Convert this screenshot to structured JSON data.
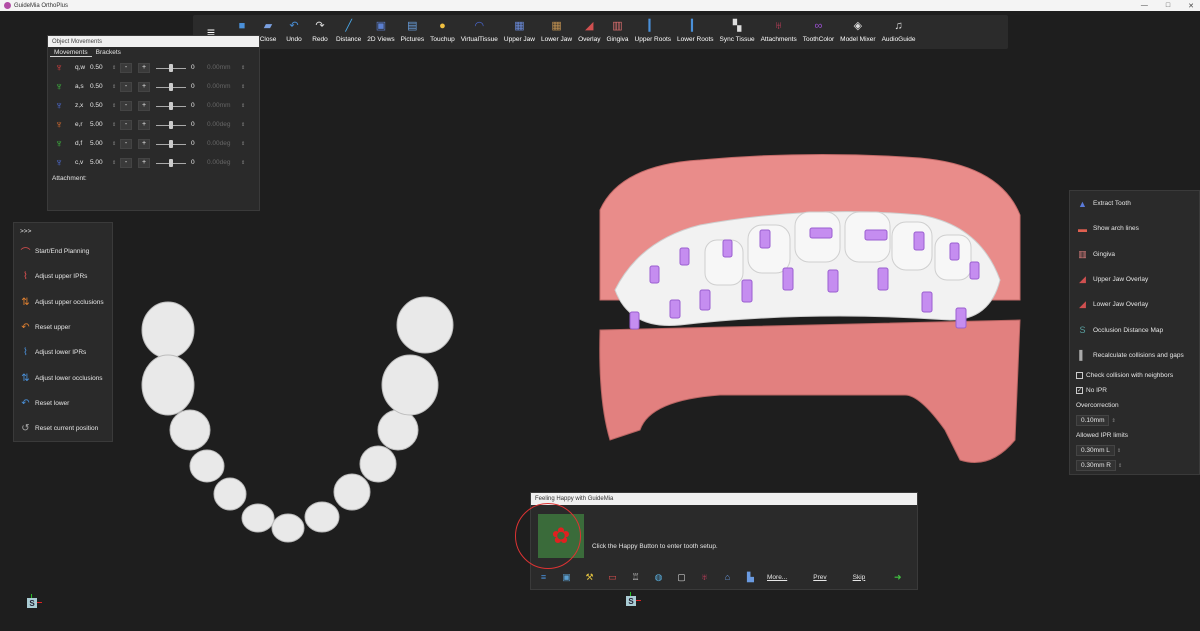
{
  "app": {
    "title": "GuideMia OrthoPlus"
  },
  "window_controls": {
    "minimize": "—",
    "maximize": "□",
    "close": "✕"
  },
  "toolbar": {
    "menu_icon": "≡",
    "items": [
      {
        "icon": "save-icon",
        "glyph": "■",
        "color": "#4a90d9",
        "label": ""
      },
      {
        "icon": "close-icon",
        "glyph": "▰",
        "color": "#7aa0e0",
        "label": "Close"
      },
      {
        "icon": "undo-icon",
        "glyph": "↶",
        "color": "#4a90d9",
        "label": "Undo"
      },
      {
        "icon": "redo-icon",
        "glyph": "↷",
        "color": "#dddddd",
        "label": "Redo"
      },
      {
        "icon": "ruler-icon",
        "glyph": "╱",
        "color": "#4aa8e8",
        "label": "Distance"
      },
      {
        "icon": "2d-views-icon",
        "glyph": "▣",
        "color": "#5b7fd0",
        "label": "2D Views"
      },
      {
        "icon": "pictures-icon",
        "glyph": "▤",
        "color": "#6aa0e0",
        "label": "Pictures"
      },
      {
        "icon": "touchup-icon",
        "glyph": "●",
        "color": "#f0c040",
        "label": "Touchup"
      },
      {
        "icon": "virtual-tissue-icon",
        "glyph": "◠",
        "color": "#4a6ad9",
        "label": "VirtualTissue"
      },
      {
        "icon": "upper-jaw-icon",
        "glyph": "▦",
        "color": "#6a8ad9",
        "label": "Upper Jaw"
      },
      {
        "icon": "lower-jaw-icon",
        "glyph": "▦",
        "color": "#c09050",
        "label": "Lower Jaw"
      },
      {
        "icon": "overlay-icon",
        "glyph": "◢",
        "color": "#d05050",
        "label": "Overlay"
      },
      {
        "icon": "gingiva-icon",
        "glyph": "▥",
        "color": "#e07070",
        "label": "Gingiva"
      },
      {
        "icon": "upper-roots-icon",
        "glyph": "▎",
        "color": "#4a90d9",
        "label": "Upper Roots"
      },
      {
        "icon": "lower-roots-icon",
        "glyph": "▎",
        "color": "#4a90d9",
        "label": "Lower Roots"
      },
      {
        "icon": "sync-tissue-icon",
        "glyph": "▚",
        "color": "#dddddd",
        "label": "Sync Tissue"
      },
      {
        "icon": "attachments-icon",
        "glyph": "♅",
        "color": "#d04060",
        "label": "Attachments"
      },
      {
        "icon": "tooth-color-icon",
        "glyph": "∞",
        "color": "#9a50d0",
        "label": "ToothColor"
      },
      {
        "icon": "model-mixer-icon",
        "glyph": "◈",
        "color": "#dddddd",
        "label": "Model Mixer"
      },
      {
        "icon": "audio-guide-icon",
        "glyph": "♫",
        "color": "#dddddd",
        "label": "AudioGuide"
      }
    ]
  },
  "object_movements": {
    "title": "Object Movements",
    "tabs": [
      "Movements",
      "Brackets"
    ],
    "rows": [
      {
        "icon": "tooth-tip-icon",
        "color": "#e04040",
        "key": "q,w",
        "value": "0.50",
        "minus": "-",
        "plus": "+",
        "slider_value": "0",
        "output": "0.00mm"
      },
      {
        "icon": "tooth-torque-icon",
        "color": "#40c040",
        "key": "a,s",
        "value": "0.50",
        "minus": "-",
        "plus": "+",
        "slider_value": "0",
        "output": "0.00mm"
      },
      {
        "icon": "tooth-intrude-icon",
        "color": "#5070e0",
        "key": "z,x",
        "value": "0.50",
        "minus": "-",
        "plus": "+",
        "slider_value": "0",
        "output": "0.00mm"
      },
      {
        "icon": "tooth-rotate-icon",
        "color": "#e07030",
        "key": "e,r",
        "value": "5.00",
        "minus": "-",
        "plus": "+",
        "slider_value": "0",
        "output": "0.00deg"
      },
      {
        "icon": "tooth-angulate-icon",
        "color": "#40c040",
        "key": "d,f",
        "value": "5.00",
        "minus": "-",
        "plus": "+",
        "slider_value": "0",
        "output": "0.00deg"
      },
      {
        "icon": "tooth-tilt-icon",
        "color": "#5070e0",
        "key": "c,v",
        "value": "5.00",
        "minus": "-",
        "plus": "+",
        "slider_value": "0",
        "output": "0.00deg"
      }
    ],
    "attachment_label": "Attachment:",
    "spin_glyph": "⇕"
  },
  "left_panel": {
    "collapse": ">>>",
    "items": [
      {
        "icon": "planning-icon",
        "glyph": "⌒",
        "color": "#e05050",
        "label": "Start/End Planning"
      },
      {
        "icon": "upper-ipr-icon",
        "glyph": "⌇",
        "color": "#e05050",
        "label": "Adjust upper IPRs"
      },
      {
        "icon": "upper-occlusion-icon",
        "glyph": "⇅",
        "color": "#e08030",
        "label": "Adjust upper occlusions"
      },
      {
        "icon": "reset-upper-icon",
        "glyph": "↶",
        "color": "#e08030",
        "label": "Reset upper"
      },
      {
        "icon": "lower-ipr-icon",
        "glyph": "⌇",
        "color": "#4a90d9",
        "label": "Adjust lower IPRs"
      },
      {
        "icon": "lower-occlusion-icon",
        "glyph": "⇅",
        "color": "#4a90d9",
        "label": "Adjust lower occlusions"
      },
      {
        "icon": "reset-lower-icon",
        "glyph": "↶",
        "color": "#4a90d9",
        "label": "Reset lower"
      },
      {
        "icon": "reset-position-icon",
        "glyph": "↺",
        "color": "#aaaaaa",
        "label": "Reset current position"
      }
    ]
  },
  "right_panel": {
    "items": [
      {
        "icon": "extract-tooth-icon",
        "glyph": "▲",
        "color": "#5a7ad9",
        "label": "Extract Tooth"
      },
      {
        "icon": "arch-lines-icon",
        "glyph": "▬",
        "color": "#e06050",
        "label": "Show arch lines"
      },
      {
        "icon": "gingiva-icon",
        "glyph": "▥",
        "color": "#e08080",
        "label": "Gingiva"
      },
      {
        "icon": "upper-jaw-overlay-icon",
        "glyph": "◢",
        "color": "#d05050",
        "label": "Upper Jaw Overlay"
      },
      {
        "icon": "lower-jaw-overlay-icon",
        "glyph": "◢",
        "color": "#d05050",
        "label": "Lower Jaw Overlay"
      },
      {
        "icon": "occlusion-map-icon",
        "glyph": "S",
        "color": "#5aa0a0",
        "label": "Occlusion Distance Map"
      },
      {
        "icon": "recalculate-icon",
        "glyph": "▌",
        "color": "#aaaaaa",
        "label": "Recalculate collisions and gaps"
      }
    ],
    "check_collision": {
      "label": "Check collision with neighbors",
      "checked": ""
    },
    "no_ipr": {
      "label": "No IPR",
      "checked": "✓"
    },
    "overcorrection_label": "Overcorrection",
    "overcorrection_value": "0.10mm",
    "ipr_limits_label": "Allowed IPR limits",
    "ipr_l": "0.30mm L",
    "ipr_r": "0.30mm R",
    "spin_glyph": "⇕"
  },
  "happy_dialog": {
    "title": "Feeling Happy with GuideMia",
    "button_icon": "clover-icon",
    "button_glyph": "✿",
    "message": "Click the Happy Button to enter tooth setup.",
    "footer_icons": [
      {
        "icon": "menu-icon",
        "glyph": "≡",
        "color": "#4a90d9"
      },
      {
        "icon": "picture-icon",
        "glyph": "▣",
        "color": "#5b9fd0"
      },
      {
        "icon": "tools-icon",
        "glyph": "⚒",
        "color": "#e0c040"
      },
      {
        "icon": "bracket-icon",
        "glyph": "▭",
        "color": "#e05050"
      },
      {
        "icon": "tooth-icon",
        "glyph": "♖",
        "color": "#cccccc"
      },
      {
        "icon": "palette-icon",
        "glyph": "◍",
        "color": "#5ab0e0"
      },
      {
        "icon": "monitor-icon",
        "glyph": "▢",
        "color": "#dddddd"
      },
      {
        "icon": "attachment-icon",
        "glyph": "♅",
        "color": "#d04060"
      },
      {
        "icon": "bank-icon",
        "glyph": "⌂",
        "color": "#6a9ae0"
      },
      {
        "icon": "chart-icon",
        "glyph": "▙",
        "color": "#6a9ae0"
      }
    ],
    "more": "More...",
    "prev": "Prev",
    "skip": "Skip",
    "next_icon": "arrow-next-icon"
  },
  "axis_indicator": {
    "label": "S"
  }
}
